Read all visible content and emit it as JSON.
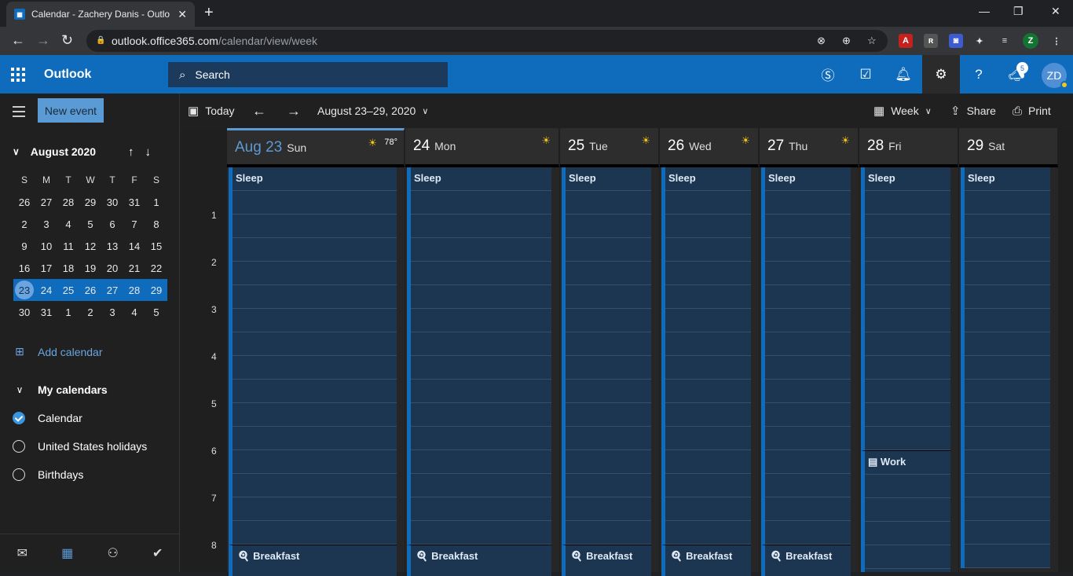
{
  "browser": {
    "tab_title": "Calendar - Zachery Danis - Outlo",
    "url_host": "outlook.office365.com",
    "url_path": "/calendar/view/week",
    "profile_initial": "Z"
  },
  "header": {
    "brand": "Outlook",
    "search_placeholder": "Search",
    "avatar_initials": "ZD",
    "notification_count": "5"
  },
  "sidebar": {
    "new_event_label": "New event",
    "month_label": "August 2020",
    "dow": [
      "S",
      "M",
      "T",
      "W",
      "T",
      "F",
      "S"
    ],
    "weeks": [
      [
        "26",
        "27",
        "28",
        "29",
        "30",
        "31",
        "1"
      ],
      [
        "2",
        "3",
        "4",
        "5",
        "6",
        "7",
        "8"
      ],
      [
        "9",
        "10",
        "11",
        "12",
        "13",
        "14",
        "15"
      ],
      [
        "16",
        "17",
        "18",
        "19",
        "20",
        "21",
        "22"
      ],
      [
        "23",
        "24",
        "25",
        "26",
        "27",
        "28",
        "29"
      ],
      [
        "30",
        "31",
        "1",
        "2",
        "3",
        "4",
        "5"
      ]
    ],
    "add_calendar_label": "Add calendar",
    "my_calendars_label": "My calendars",
    "calendars": [
      {
        "name": "Calendar",
        "checked": true
      },
      {
        "name": "United States holidays",
        "checked": false
      },
      {
        "name": "Birthdays",
        "checked": false
      }
    ]
  },
  "toolbar": {
    "today_label": "Today",
    "range_label": "August 23–29, 2020",
    "view_label": "Week",
    "share_label": "Share",
    "print_label": "Print"
  },
  "week": {
    "hours": [
      "1",
      "2",
      "3",
      "4",
      "5",
      "6",
      "7",
      "8"
    ],
    "days": [
      {
        "num": "Aug 23",
        "name": "Sun",
        "weather": "78°",
        "current": true
      },
      {
        "num": "24",
        "name": "Mon",
        "weather": "",
        "current": false
      },
      {
        "num": "25",
        "name": "Tue",
        "weather": "",
        "current": false
      },
      {
        "num": "26",
        "name": "Wed",
        "weather": "",
        "current": false
      },
      {
        "num": "27",
        "name": "Thu",
        "weather": "",
        "current": false
      },
      {
        "num": "28",
        "name": "Fri",
        "weather": "",
        "current": false
      },
      {
        "num": "29",
        "name": "Sat",
        "weather": "",
        "current": false
      }
    ],
    "events": {
      "sleep": "Sleep",
      "breakfast": "Breakfast",
      "work": "Work"
    }
  },
  "colors": {
    "brand": "#0f6cbd",
    "event_bg": "#1c3550",
    "accent_light": "#5b9bd5"
  }
}
